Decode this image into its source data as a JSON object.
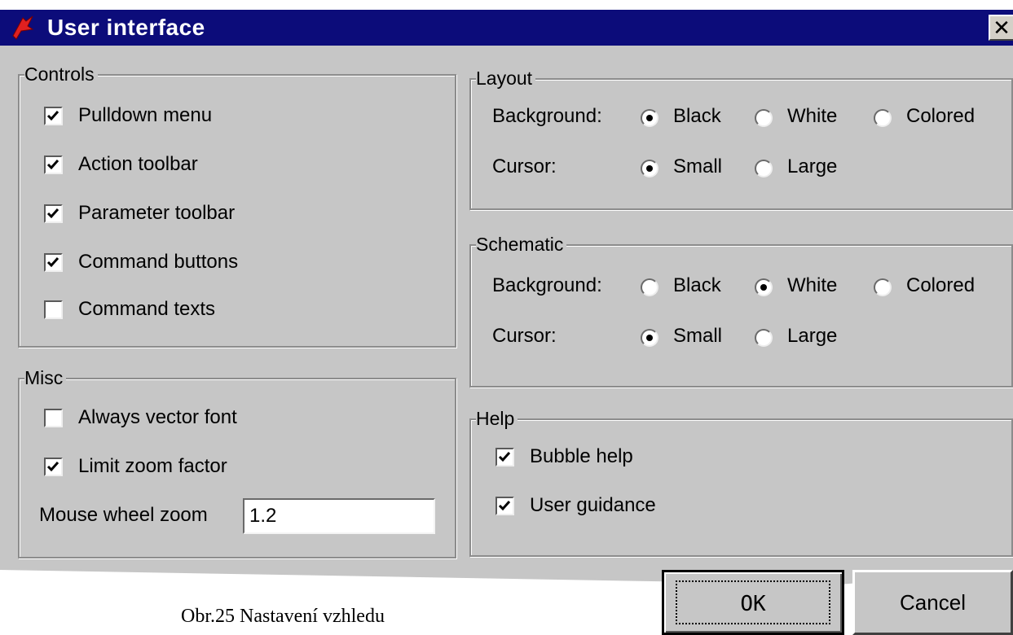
{
  "window": {
    "title": "User interface",
    "close_label": "✕"
  },
  "controls": {
    "legend": "Controls",
    "items": [
      {
        "label": "Pulldown menu",
        "checked": true
      },
      {
        "label": "Action toolbar",
        "checked": true
      },
      {
        "label": "Parameter toolbar",
        "checked": true
      },
      {
        "label": "Command buttons",
        "checked": true
      },
      {
        "label": "Command texts",
        "checked": false
      }
    ]
  },
  "misc": {
    "legend": "Misc",
    "items": [
      {
        "label": "Always vector font",
        "checked": false
      },
      {
        "label": "Limit zoom factor",
        "checked": true
      }
    ],
    "wheel_zoom_label": "Mouse wheel zoom",
    "wheel_zoom_value": "1.2"
  },
  "layout": {
    "legend": "Layout",
    "background_label": "Background:",
    "background_options": [
      "Black",
      "White",
      "Colored"
    ],
    "background_selected": "Black",
    "cursor_label": "Cursor:",
    "cursor_options": [
      "Small",
      "Large"
    ],
    "cursor_selected": "Small"
  },
  "schematic": {
    "legend": "Schematic",
    "background_label": "Background:",
    "background_options": [
      "Black",
      "White",
      "Colored"
    ],
    "background_selected": "White",
    "cursor_label": "Cursor:",
    "cursor_options": [
      "Small",
      "Large"
    ],
    "cursor_selected": "Small"
  },
  "help": {
    "legend": "Help",
    "items": [
      {
        "label": "Bubble help",
        "checked": true
      },
      {
        "label": "User guidance",
        "checked": true
      }
    ]
  },
  "buttons": {
    "ok": "OK",
    "cancel": "Cancel"
  },
  "caption": "Obr.25 Nastavení vzhledu",
  "colors": {
    "titlebar": "#0c0c7a",
    "face": "#c6c6c6",
    "icon": "#e02020"
  },
  "icons": {
    "app": "eagle-app-icon",
    "close": "close-icon",
    "check": "checkmark-icon"
  }
}
